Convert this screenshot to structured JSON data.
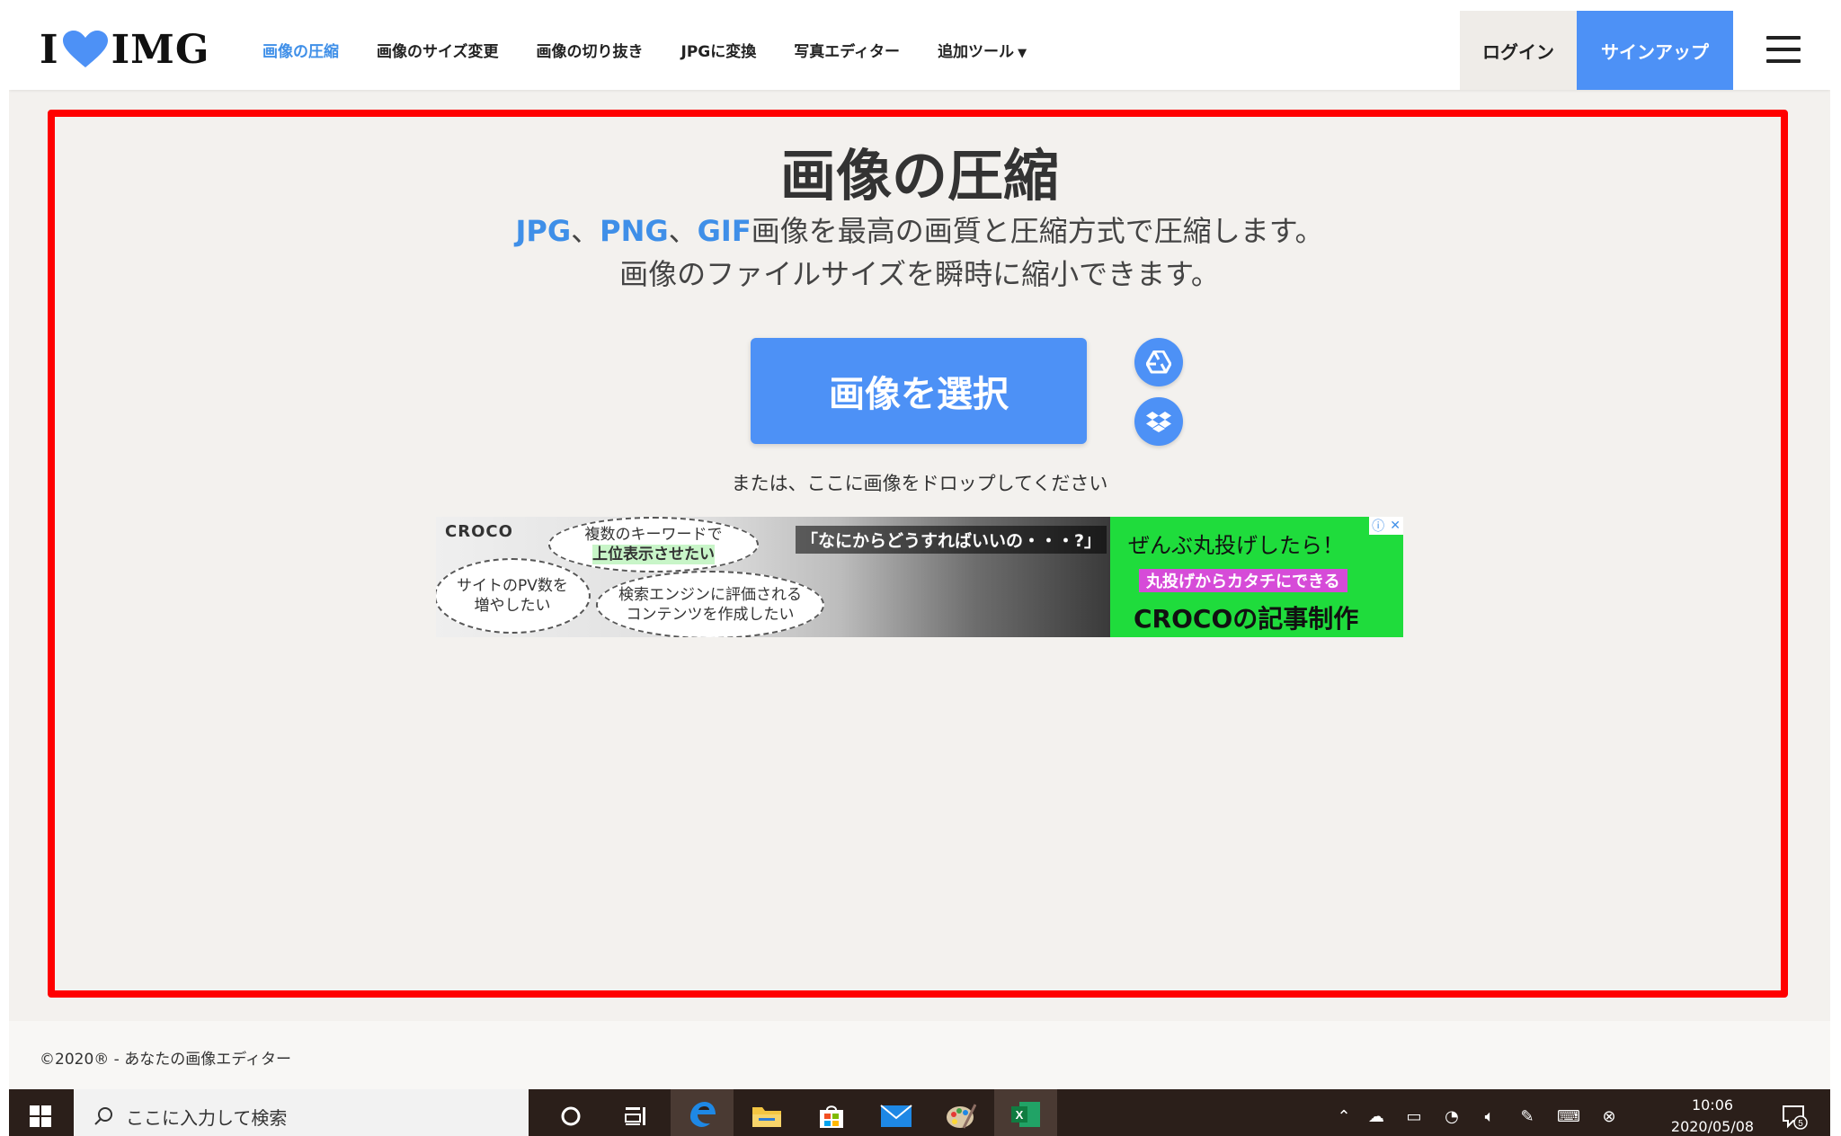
{
  "header": {
    "logo_left": "I",
    "logo_right": "IMG",
    "nav": [
      {
        "label": "画像の圧縮"
      },
      {
        "label": "画像のサイズ変更"
      },
      {
        "label": "画像の切り抜き"
      },
      {
        "label": "JPGに変換"
      },
      {
        "label": "写真エディター"
      },
      {
        "label": "追加ツール"
      }
    ],
    "login": "ログイン",
    "signup": "サインアップ"
  },
  "main": {
    "title": "画像の圧縮",
    "formats": [
      "JPG",
      "PNG",
      "GIF"
    ],
    "sep": "、",
    "sub1_rest": "画像を最高の画質と圧縮方式で圧縮します。",
    "sub2": "画像のファイルサイズを瞬時に縮小できます。",
    "select_button": "画像を選択",
    "drop_text": "または、ここに画像をドロップしてください"
  },
  "ad": {
    "brand": "CROCO",
    "bubble1_line1": "複数のキーワードで",
    "bubble1_line2": "上位表示させたい",
    "bubble2_line1": "サイトのPV数を",
    "bubble2_line2": "増やしたい",
    "bubble3_line1": "検索エンジンに評価される",
    "bubble3_line2": "コンテンツを作成したい",
    "quote": "「なにからどうすればいいの・・・?」",
    "green_line1": "ぜんぶ丸投げしたら！",
    "green_line2": "丸投げからカタチにできる",
    "green_line3": "CROCOの記事制作"
  },
  "footer": {
    "copyright": "©2020® - あなたの画像エディター"
  },
  "taskbar": {
    "search_placeholder": "ここに入力して検索",
    "time": "10:06",
    "date": "2020/05/08",
    "notification_count": "5"
  },
  "colors": {
    "accent": "#4d91f6",
    "highlight_border": "#ff0000",
    "page_bg": "#f3f1ee"
  }
}
